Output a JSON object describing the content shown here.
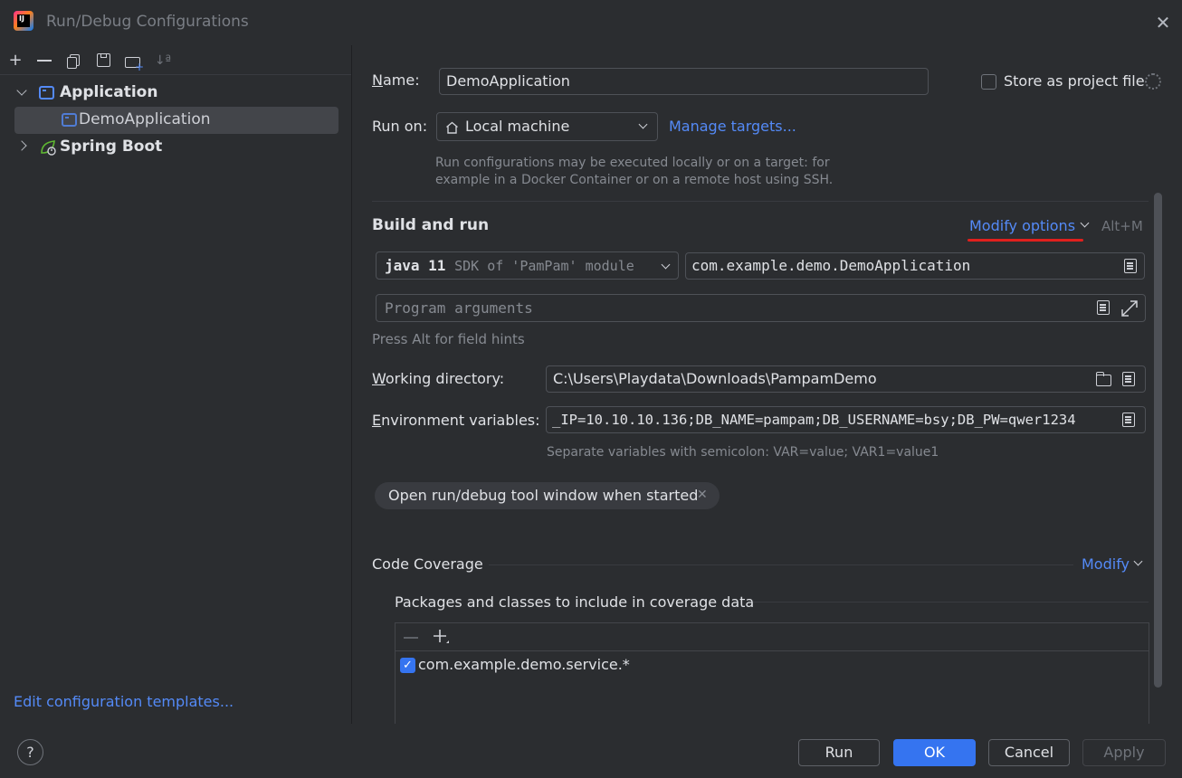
{
  "window": {
    "title": "Run/Debug Configurations",
    "close_glyph": "✕"
  },
  "toolbar": {
    "add": "+",
    "remove": "—",
    "copy": "⧉",
    "save": "💾",
    "folder": "🗀",
    "sort": "↓ª"
  },
  "tree": {
    "application": {
      "label": "Application",
      "expanded_glyph": "⌄"
    },
    "selected_item": {
      "label": "DemoApplication"
    },
    "spring_boot": {
      "label": "Spring Boot",
      "collapsed_glyph": "›"
    }
  },
  "left_footer": {
    "edit_templates": "Edit configuration templates..."
  },
  "form": {
    "name_label": "Name:",
    "name_value": "DemoApplication",
    "store_label": "Store as project file",
    "run_on_label": "Run on:",
    "run_on_value": "Local machine",
    "manage_targets": "Manage targets...",
    "run_on_hint_1": "Run configurations may be executed locally or on a target: for",
    "run_on_hint_2": "example in a Docker Container or on a remote host using SSH.",
    "build_run_title": "Build and run",
    "modify_options": "Modify options",
    "modify_shortcut": "Alt+M",
    "sdk_main": "java 11",
    "sdk_detail": "SDK of 'PamPam' module",
    "main_class": "com.example.demo.DemoApplication",
    "program_args_placeholder": "Program arguments",
    "field_hint": "Press Alt for field hints",
    "workdir_label": "Working directory:",
    "workdir_value": "C:\\Users\\Playdata\\Downloads\\PampamDemo",
    "env_label": "Environment variables:",
    "env_value": "_IP=10.10.10.136;DB_NAME=pampam;DB_USERNAME=bsy;DB_PW=qwer1234",
    "env_hint": "Separate variables with semicolon: VAR=value; VAR1=value1",
    "chip_label": "Open run/debug tool window when started",
    "coverage_title": "Code Coverage",
    "coverage_modify": "Modify",
    "packages_title": "Packages and classes to include in coverage data",
    "package_item": "com.example.demo.service.*"
  },
  "buttons": {
    "help": "?",
    "run": "Run",
    "ok": "OK",
    "cancel": "Cancel",
    "apply": "Apply"
  },
  "colors": {
    "accent": "#3574f0",
    "link": "#548af7",
    "highlight": "#e0201d"
  }
}
